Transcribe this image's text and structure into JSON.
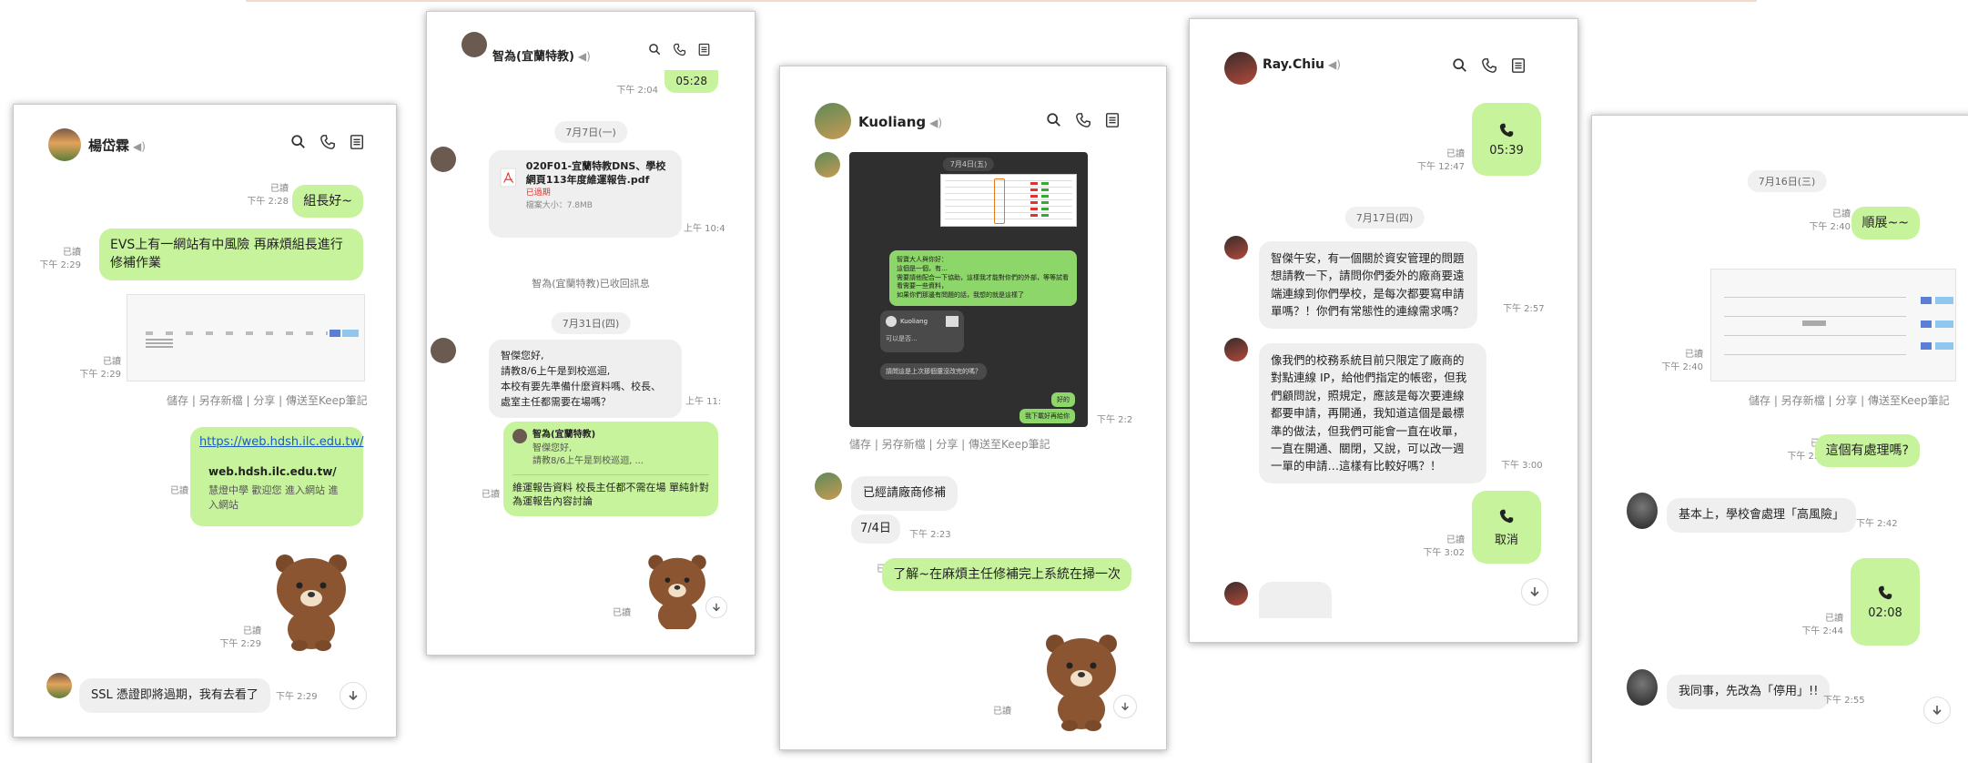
{
  "colors": {
    "bubble_out": "#c6f39b",
    "bubble_in": "#efefef",
    "dark_screenshot": "#2f2f2f",
    "link": "#1a5ac9"
  },
  "panel1": {
    "title": "楊岱霖",
    "msgs": {
      "m1": "組長好~",
      "m1_read": "已讀",
      "m1_time": "下午 2:28",
      "m2": "EVS上有一網站有中風險 再麻煩組長進行修補作業",
      "m2_read": "已讀",
      "m2_time": "下午 2:29",
      "m3_read": "已讀",
      "m3_time": "下午 2:29",
      "actions": "儲存 | 另存新檔 | 分享 | 傳送至Keep筆記",
      "link_url": "https://web.hdsh.ilc.edu.tw/",
      "link_domain": "web.hdsh.ilc.edu.tw/",
      "link_desc": "慧燈中學 歡迎您 進入網站 進入網站",
      "m4_read": "已讀",
      "sticker_read": "已讀",
      "sticker_time": "下午 2:29",
      "m5": "SSL 憑證即將過期，我有去看了",
      "m5_time": "下午 2:29"
    }
  },
  "panel2": {
    "title": "智為(宜蘭特教)",
    "msgs": {
      "top_time": "下午 2:04",
      "top_bubble": "05:28",
      "date1": "7月7日(一)",
      "file_name": "020F01-宜蘭特教DNS、學校網頁113年度維運報告.pdf",
      "file_status": "已過期",
      "file_size": "檔案大小：7.8MB",
      "file_time": "上午 10:4",
      "system": "智為(宜蘭特教)已收回訊息",
      "date2": "7月31日(四)",
      "m1": "智傑您好,\n請教8/6上午是到校巡迴,\n本校有要先準備什麼資料嗎、校長、處室主任都需要在場嗎？",
      "m1_time": "上午 11:",
      "reply_name": "智為(宜蘭特教)",
      "reply_text": "智傑您好,\n請教8/6上午是到校巡迴,  ...",
      "reply_body": "維運報告資料 校長主任都不需在場 單純針對為運報告內容討論",
      "reply_read": "已讀",
      "sticker_read": "已讀"
    }
  },
  "panel3": {
    "title": "Kuoliang",
    "msgs": {
      "shot_date": "7月4日(五)",
      "shot_bubble": "智寶大人與你好：\n這個是一個，有…\n需要請他配合一下協助，這樣我才能對你們的外部，等等試看看需要一些資料，\n如果你們那邊有問題的話，我想的就是這樣了",
      "shot_user": "Kuoliang",
      "shot_in1": "可以是否...",
      "shot_in2": "請問這是上次那個還沒改完的嗎？",
      "shot_out1": "好的",
      "shot_out2": "我下載好再給你",
      "shot_time": "下午 2:2",
      "actions": "儲存 | 另存新檔 | 分享 | 傳送至Keep筆記",
      "m1": "已經請廠商修補",
      "m2": "7/4日",
      "m2_time": "下午 2:23",
      "m3": "了解~在麻煩主任修補完上系統在掃一次",
      "m3_read": "已讀",
      "sticker_time": "已讀"
    }
  },
  "panel4": {
    "title": "Ray.Chiu",
    "msgs": {
      "call1": "05:39",
      "call1_read": "已讀",
      "call1_time": "下午 12:47",
      "date1": "7月17日(四)",
      "m1": "智傑午安，有一個關於資安管理的問題想請教一下，請問你們委外的廠商要遠端連線到你們學校，是每次都要寫申請單嗎？！你們有常態性的連線需求嗎？",
      "m1_time": "下午 2:57",
      "m2": "像我們的校務系統目前只限定了廠商的對點連線 IP，給他們指定的帳密，但我們顧問說，照規定，應該是每次要連線都要申請，再開通，我知道這個是最標準的做法，但我們可能會一直在收單，一直在開通、關閉，又說，可以改一週一單的申請…這樣有比較好嗎？！",
      "m2_time": "下午 3:00",
      "call2": "取消",
      "call2_read": "已讀",
      "call2_time": "下午 3:02"
    }
  },
  "panel5": {
    "msgs": {
      "date1": "7月16日(三)",
      "m1": "順展~~",
      "m1_read": "已讀",
      "m1_time": "下午 2:40",
      "shot_read": "已讀",
      "shot_time": "下午 2:40",
      "actions": "儲存 | 另存新檔 | 分享 | 傳送至Keep筆記",
      "m2": "這個有處理嗎?",
      "m2_read": "已讀",
      "m2_time": "下午 2:40",
      "m3": "基本上，學校會處理「高風險」",
      "m3_time": "下午 2:42",
      "call1": "02:08",
      "call1_read": "已讀",
      "call1_time": "下午 2:44",
      "m4": "我同事，先改為「停用」!!",
      "m4_time": "下午 2:55"
    }
  }
}
